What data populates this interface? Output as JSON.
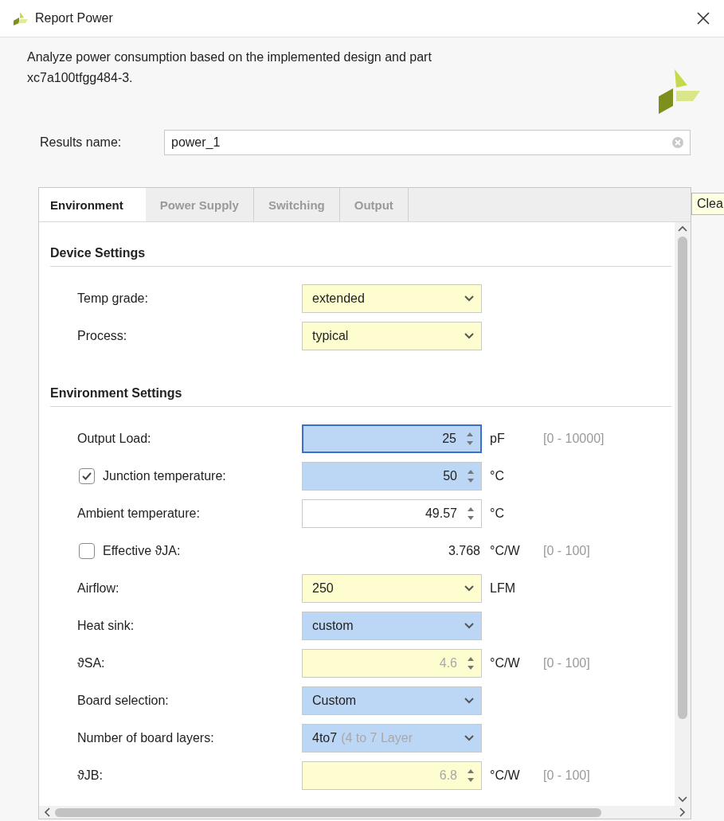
{
  "window": {
    "title": "Report Power"
  },
  "description": "Analyze power consumption based on the implemented design and part xc7a100tfgg484-3.",
  "results_name": {
    "label": "Results name:",
    "value": "power_1"
  },
  "tooltip": "Clea",
  "tabs": [
    {
      "label": "Environment",
      "selected": true
    },
    {
      "label": "Power Supply",
      "selected": false
    },
    {
      "label": "Switching",
      "selected": false
    },
    {
      "label": "Output",
      "selected": false
    }
  ],
  "sections": [
    {
      "title": "Device Settings",
      "rows": [
        {
          "label": "Temp grade:",
          "kind": "combo",
          "value": "extended",
          "color": "#fdfdd0",
          "focused": false,
          "disabled": false
        },
        {
          "label": "Process:",
          "kind": "combo",
          "value": "typical",
          "color": "#fdfdd0",
          "focused": false,
          "disabled": false
        }
      ]
    },
    {
      "title": "Environment Settings",
      "rows": [
        {
          "label": "Output Load:",
          "kind": "spinner",
          "value": "25",
          "color": "#bcd7f5",
          "focused": true,
          "disabled": false,
          "unit": "pF",
          "range": "[0 - 10000]"
        },
        {
          "label": "Junction temperature:",
          "checkbox": {
            "checked": true
          },
          "kind": "spinner",
          "value": "50",
          "color": "#bcd7f5",
          "focused": false,
          "disabled": false,
          "unit": "°C"
        },
        {
          "label": "Ambient temperature:",
          "kind": "spinner",
          "value": "49.57",
          "color": "#ffffff",
          "focused": false,
          "disabled": false,
          "unit": "°C"
        },
        {
          "label": "Effective ϑJA:",
          "checkbox": {
            "checked": false
          },
          "kind": "value",
          "value": "3.768",
          "focused": false,
          "disabled": false,
          "unit": "°C/W",
          "range": "[0 - 100]"
        },
        {
          "label": "Airflow:",
          "kind": "combo",
          "value": "250",
          "color": "#fdfdd0",
          "focused": false,
          "disabled": false,
          "unit": "LFM"
        },
        {
          "label": "Heat sink:",
          "kind": "combo",
          "value": "custom",
          "color": "#bcd7f5",
          "focused": false,
          "disabled": false
        },
        {
          "label": "ϑSA:",
          "kind": "spinner",
          "value": "4.6",
          "color": "#fdfdd0",
          "focused": false,
          "disabled": true,
          "unit": "°C/W",
          "range": "[0 - 100]"
        },
        {
          "label": "Board selection:",
          "kind": "combo",
          "value": "Custom",
          "color": "#bcd7f5",
          "focused": false,
          "disabled": false
        },
        {
          "label": "Number of board layers:",
          "kind": "combo",
          "value": "4to7",
          "detail": "(4 to 7 Layer",
          "color": "#bcd7f5",
          "focused": false,
          "disabled": false
        },
        {
          "label": "ϑJB:",
          "kind": "spinner",
          "value": "6.8",
          "color": "#fdfdd0",
          "focused": false,
          "disabled": true,
          "unit": "°C/W",
          "range": "[0 - 100]"
        }
      ]
    }
  ]
}
